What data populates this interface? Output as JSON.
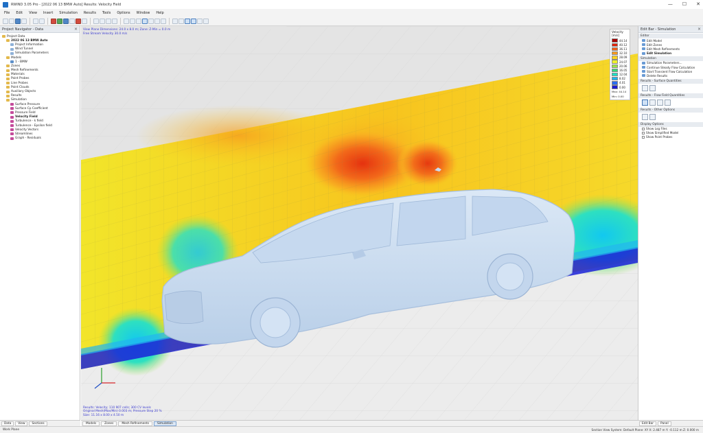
{
  "window": {
    "title": "RWIND 3.05 Pro - [2022 06 13 BMW Auto] Results: Velocity Field",
    "controls": [
      "—",
      "☐",
      "✕"
    ]
  },
  "menu": [
    "File",
    "Edit",
    "View",
    "Insert",
    "Simulation",
    "Results",
    "Tools",
    "Options",
    "Window",
    "Help"
  ],
  "left_panel": {
    "title": "Project Navigator - Data",
    "tree": [
      {
        "label": "Project Data",
        "depth": 0,
        "icon": "folder-icon",
        "bold": false
      },
      {
        "label": "2022 06 13 BMW Auto",
        "depth": 1,
        "icon": "folder-icon",
        "bold": true
      },
      {
        "label": "Project Information",
        "depth": 2,
        "icon": "doc-icon",
        "bold": false
      },
      {
        "label": "Wind Tunnel",
        "depth": 2,
        "icon": "doc-icon",
        "bold": false
      },
      {
        "label": "Simulation Parameters",
        "depth": 2,
        "icon": "doc-icon",
        "bold": false
      },
      {
        "label": "Models",
        "depth": 1,
        "icon": "folder-icon",
        "bold": false
      },
      {
        "label": "1 - BMW",
        "depth": 2,
        "icon": "car-icon",
        "bold": false
      },
      {
        "label": "Zones",
        "depth": 1,
        "icon": "folder-icon",
        "bold": false
      },
      {
        "label": "Mesh Refinements",
        "depth": 1,
        "icon": "folder-icon",
        "bold": false
      },
      {
        "label": "Materials",
        "depth": 1,
        "icon": "folder-icon",
        "bold": false
      },
      {
        "label": "Point Probes",
        "depth": 1,
        "icon": "folder-icon",
        "bold": false
      },
      {
        "label": "Line Probes",
        "depth": 1,
        "icon": "folder-icon",
        "bold": false
      },
      {
        "label": "Point Clouds",
        "depth": 1,
        "icon": "folder-icon",
        "bold": false
      },
      {
        "label": "Auxiliary Objects",
        "depth": 1,
        "icon": "folder-icon",
        "bold": false
      },
      {
        "label": "Results",
        "depth": 1,
        "icon": "folder-icon",
        "bold": false
      },
      {
        "label": "Simulation",
        "depth": 1,
        "icon": "folder-icon",
        "bold": false
      },
      {
        "label": "Surface Pressure",
        "depth": 2,
        "icon": "result-icon",
        "bold": false
      },
      {
        "label": "Surface Cp Coefficient",
        "depth": 2,
        "icon": "result-icon",
        "bold": false
      },
      {
        "label": "Pressure Field",
        "depth": 2,
        "icon": "result-icon",
        "bold": false
      },
      {
        "label": "Velocity Field",
        "depth": 2,
        "icon": "result-icon",
        "bold": true
      },
      {
        "label": "Turbulence - k field",
        "depth": 2,
        "icon": "result-icon",
        "bold": false
      },
      {
        "label": "Turbulence - Epsilon field",
        "depth": 2,
        "icon": "result-icon",
        "bold": false
      },
      {
        "label": "Velocity Vectors",
        "depth": 2,
        "icon": "result-icon",
        "bold": false
      },
      {
        "label": "Streamlines",
        "depth": 2,
        "icon": "result-icon",
        "bold": false
      },
      {
        "label": "Graph - Residuals",
        "depth": 2,
        "icon": "result-icon",
        "bold": false
      }
    ],
    "tabs": [
      "Data",
      "View",
      "Sections"
    ]
  },
  "viewport": {
    "info_lines": [
      "View Plane Dimensions: 24.0 x 8.0 m; Zone: Z-Min = 0.0 m",
      "Free Stream Velocity 30.0 m/s"
    ],
    "bottom_lines": [
      "Results: Velocity; 110 907 cells; 300 CV levels",
      "Original Mesh(Max/Min) 0.003 m; Pressure Step 20 %",
      "Size: 11.16 x 8.00 x 4.50 m"
    ],
    "tabs": [
      "Models",
      "Zones",
      "Mesh Refinements",
      "Simulation"
    ],
    "active_tab": "Simulation"
  },
  "legend": {
    "title": "Velocity [m/s]",
    "entries": [
      {
        "value": "44.14",
        "color": "#a80000"
      },
      {
        "value": "40.12",
        "color": "#e0260e"
      },
      {
        "value": "36.11",
        "color": "#f4621a"
      },
      {
        "value": "32.10",
        "color": "#fb9b1e"
      },
      {
        "value": "28.09",
        "color": "#fcd21e"
      },
      {
        "value": "24.07",
        "color": "#eef02a"
      },
      {
        "value": "20.06",
        "color": "#9be447"
      },
      {
        "value": "16.05",
        "color": "#37d87a"
      },
      {
        "value": "12.04",
        "color": "#1fe0c8"
      },
      {
        "value": "8.02",
        "color": "#1cb4f0"
      },
      {
        "value": "4.01",
        "color": "#2a6cf0"
      },
      {
        "value": "0.00",
        "color": "#1a1ad0"
      }
    ],
    "max_label": "Max: 44.14",
    "min_label": "Min: 0.00"
  },
  "right_panel": {
    "title": "Edit Bar - Simulation",
    "sections": [
      {
        "header": "Editor",
        "items": [
          {
            "label": "Edit Model",
            "bold": false
          },
          {
            "label": "Edit Zones",
            "bold": false
          },
          {
            "label": "Edit Mesh Refinements",
            "bold": false
          },
          {
            "label": "Edit Simulation",
            "bold": true
          }
        ]
      },
      {
        "header": "Simulation",
        "items": [
          {
            "label": "Simulation Parameters...",
            "bold": false
          },
          {
            "label": "Continue Steady Flow Calculation",
            "bold": false
          },
          {
            "label": "Start Transient Flow Calculation",
            "bold": false
          },
          {
            "label": "Delete Results",
            "bold": false
          }
        ]
      },
      {
        "header": "Results - Surface Quantities",
        "items": []
      },
      {
        "header": "Results - Flow Field Quantities",
        "items": []
      },
      {
        "header": "Results - Other Options",
        "items": []
      },
      {
        "header": "Display Options",
        "items": [
          {
            "label": "Show Log Files",
            "bold": false
          },
          {
            "label": "Show Simplified Model",
            "bold": false
          },
          {
            "label": "Show Point Probes",
            "bold": false
          }
        ]
      }
    ],
    "tabs": [
      "Edit Bar",
      "Panel"
    ]
  },
  "status": {
    "left": "Work Plane",
    "right": "Section View  System: Default  Plane: XY  X: 2.487 m  Y: -0.112 m  Z: 0.000 m"
  },
  "colors": {
    "accent": "#1f6fc5",
    "car_body": "#cfe0f3",
    "floor": "#e9e9e9"
  }
}
